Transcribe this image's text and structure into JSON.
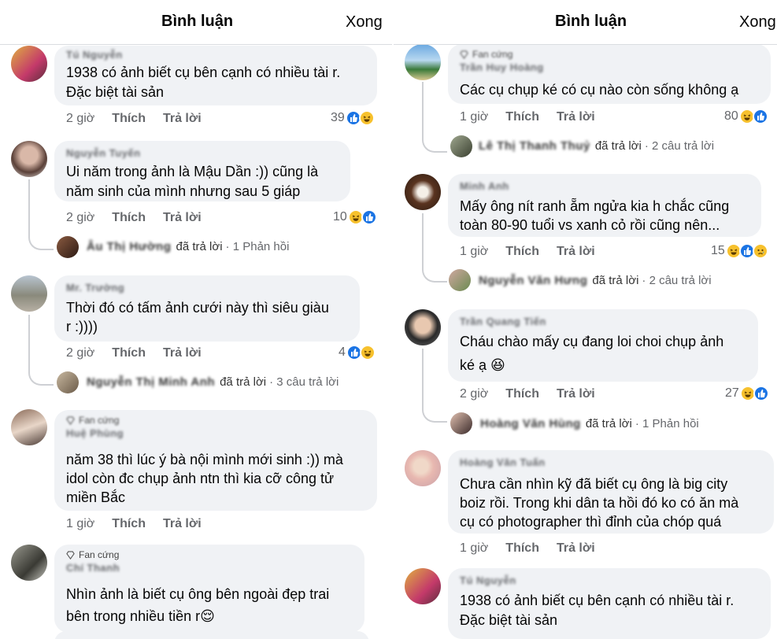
{
  "left": {
    "header": {
      "title": "Bình luận",
      "done": "Xong"
    },
    "comments": [
      {
        "name": "Tú Nguyễn",
        "lines": [
          "1938 có ảnh biết cụ bên cạnh có nhiều tài r.",
          "Đặc biệt tài sản"
        ],
        "time": "2 giờ",
        "like": "Thích",
        "reply": "Trả lời",
        "reactions": "39"
      },
      {
        "name": "Nguyễn Tuyến",
        "lines": [
          "Ui năm trong ảnh là Mậu Dần :)) cũng là",
          "năm sinh của mình nhưng sau 5 giáp"
        ],
        "time": "2 giờ",
        "like": "Thích",
        "reply": "Trả lời",
        "reactions": "10",
        "reply_preview": {
          "name": "Âu Thị Hường",
          "replied": "đã trả lời",
          "count": "· 1 Phản hồi"
        }
      },
      {
        "name": "Mr. Trường",
        "lines": [
          "Thời đó có tấm ảnh cưới này thì siêu giàu",
          "r :))))"
        ],
        "time": "2 giờ",
        "like": "Thích",
        "reply": "Trả lời",
        "reactions": "4",
        "reply_preview": {
          "name": "Nguyễn Thị Minh Anh",
          "replied": "đã trả lời",
          "count": "· 3 câu trả lời"
        }
      },
      {
        "badge": "Fan cứng",
        "name": "Huệ Phùng",
        "lines": [
          "năm 38 thì lúc ý bà nội mình mới sinh :)) mà",
          "idol còn đc chụp ảnh ntn thì kia cỡ công tử",
          "miền Bắc"
        ],
        "time": "1 giờ",
        "like": "Thích",
        "reply": "Trả lời"
      },
      {
        "badge": "Fan cứng",
        "name": "Chí Thanh",
        "lines": [
          "Nhìn ảnh là biết cụ ông bên ngoài đẹp trai",
          "bên trong nhiều tiền r😌"
        ]
      }
    ]
  },
  "right": {
    "header": {
      "title": "Bình luận",
      "done": "Xong"
    },
    "comments": [
      {
        "badge": "Fan cứng",
        "name": "Trần Huy Hoàng",
        "lines": [
          "Các cụ chụp ké có cụ nào còn sống không ạ"
        ],
        "time": "1 giờ",
        "like": "Thích",
        "reply": "Trả lời",
        "reactions": "80",
        "reply_preview": {
          "name": "Lê Thị Thanh Thuỷ",
          "replied": "đã trả lời",
          "count": "· 2 câu trả lời"
        }
      },
      {
        "name": "Minh Anh",
        "lines": [
          "Mấy ông nít ranh ẵm ngửa kia h chắc cũng",
          "toàn 80-90 tuổi vs xanh cỏ rồi cũng nên..."
        ],
        "time": "1 giờ",
        "like": "Thích",
        "reply": "Trả lời",
        "reactions": "15",
        "reply_preview": {
          "name": "Nguyễn Văn Hưng",
          "replied": "đã trả lời",
          "count": "· 2 câu trả lời"
        }
      },
      {
        "name": "Trần Quang Tiến",
        "lines": [
          "Cháu chào mấy cụ đang loi choi chụp ảnh",
          "ké ạ 😆"
        ],
        "time": "2 giờ",
        "like": "Thích",
        "reply": "Trả lời",
        "reactions": "27",
        "reply_preview": {
          "name": "Hoàng Văn Hùng",
          "replied": "đã trả lời",
          "count": "· 1 Phản hồi"
        }
      },
      {
        "name": "Hoàng Văn Tuấn",
        "lines": [
          "Chưa cần nhìn kỹ đã biết cụ ông là big city",
          "boiz rồi. Trong khi dân ta hồi đó ko có ăn mà",
          "cụ có photographer thì đỉnh của chóp quá"
        ],
        "time": "1 giờ",
        "like": "Thích",
        "reply": "Trả lời"
      },
      {
        "name": "Tú Nguyễn",
        "lines": [
          "1938 có ảnh biết cụ bên cạnh có nhiều tài r.",
          "Đặc biệt tài sản"
        ]
      }
    ]
  },
  "colors": {
    "like_blue": "#1b74e4",
    "haha_yellow": "#f7c12d",
    "bubble": "#f0f2f5",
    "meta_gray": "#65676b"
  },
  "icons": [
    "like-reaction-icon",
    "haha-reaction-icon",
    "sad-reaction-icon",
    "fan-diamond-icon"
  ]
}
